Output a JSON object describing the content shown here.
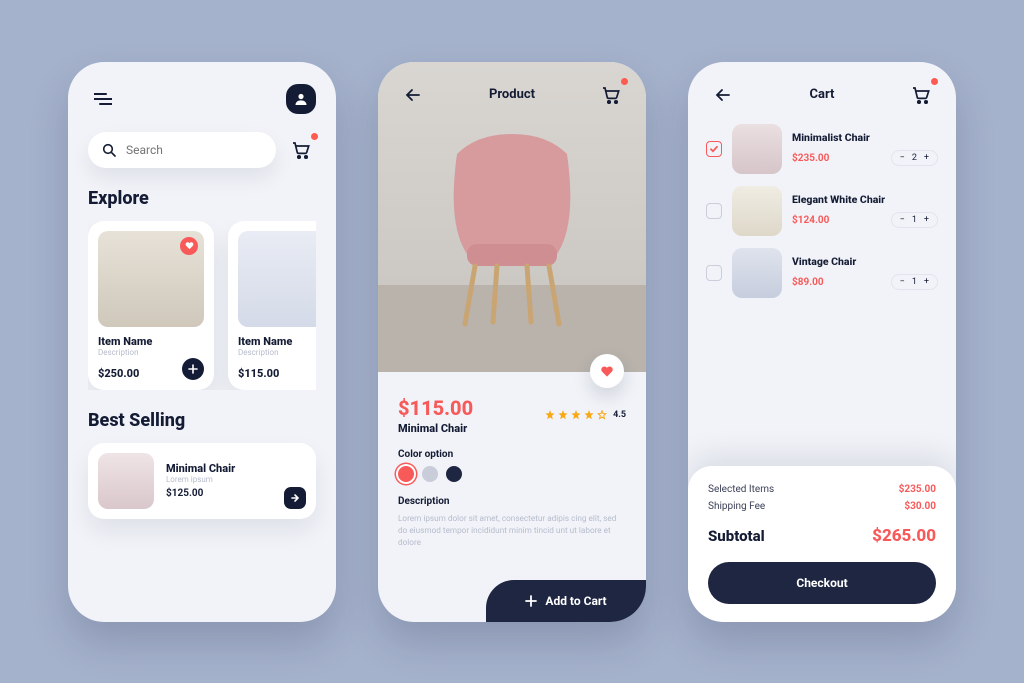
{
  "screen1": {
    "search_placeholder": "Search",
    "explore_title": "Explore",
    "bestselling_title": "Best Selling",
    "cards": [
      {
        "name": "Item Name",
        "desc": "Description",
        "price": "$250.00",
        "favorited": true
      },
      {
        "name": "Item Name",
        "desc": "Description",
        "price": "$115.00",
        "favorited": false
      }
    ],
    "best": {
      "name": "Minimal Chair",
      "desc": "Lorem ipsum",
      "price": "$125.00"
    }
  },
  "screen2": {
    "title": "Product",
    "price": "$115.00",
    "name": "Minimal Chair",
    "rating": "4.5",
    "color_label": "Color option",
    "colors": [
      "#f85a5a",
      "#c9cdda",
      "#1e2642"
    ],
    "selected_color_index": 0,
    "desc_label": "Description",
    "description": "Lorem ipsum dolor sit amet, consectetur adipis cing elit, sed do eiusmod tempor incididunt minim tincid unt ut labore et dolore",
    "add_to_cart": "Add to Cart"
  },
  "screen3": {
    "title": "Cart",
    "items": [
      {
        "name": "Minimalist Chair",
        "price": "$235.00",
        "qty": "2",
        "checked": true
      },
      {
        "name": "Elegant White Chair",
        "price": "$124.00",
        "qty": "1",
        "checked": false
      },
      {
        "name": "Vintage Chair",
        "price": "$89.00",
        "qty": "1",
        "checked": false
      }
    ],
    "summary": {
      "selected_label": "Selected Items",
      "selected_value": "$235.00",
      "shipping_label": "Shipping Fee",
      "shipping_value": "$30.00",
      "subtotal_label": "Subtotal",
      "subtotal_value": "$265.00"
    },
    "checkout": "Checkout"
  },
  "icons": {
    "search": "search-icon",
    "cart": "cart-icon",
    "menu": "menu-icon",
    "user": "user-icon",
    "back": "back-icon",
    "heart": "heart-icon",
    "plus": "plus-icon",
    "arrow": "arrow-right-icon"
  }
}
